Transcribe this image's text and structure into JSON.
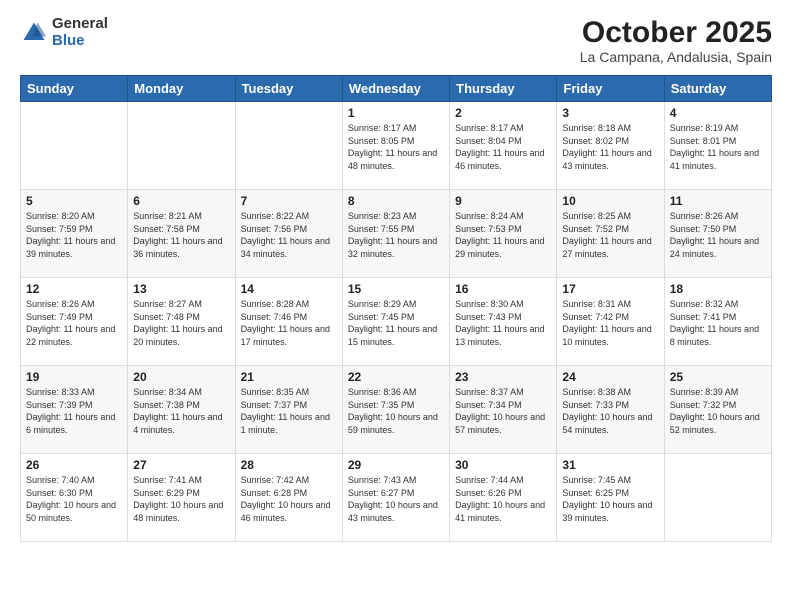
{
  "header": {
    "logo_general": "General",
    "logo_blue": "Blue",
    "month_title": "October 2025",
    "location": "La Campana, Andalusia, Spain"
  },
  "weekdays": [
    "Sunday",
    "Monday",
    "Tuesday",
    "Wednesday",
    "Thursday",
    "Friday",
    "Saturday"
  ],
  "weeks": [
    [
      {
        "day": "",
        "info": ""
      },
      {
        "day": "",
        "info": ""
      },
      {
        "day": "",
        "info": ""
      },
      {
        "day": "1",
        "info": "Sunrise: 8:17 AM\nSunset: 8:05 PM\nDaylight: 11 hours and 48 minutes."
      },
      {
        "day": "2",
        "info": "Sunrise: 8:17 AM\nSunset: 8:04 PM\nDaylight: 11 hours and 46 minutes."
      },
      {
        "day": "3",
        "info": "Sunrise: 8:18 AM\nSunset: 8:02 PM\nDaylight: 11 hours and 43 minutes."
      },
      {
        "day": "4",
        "info": "Sunrise: 8:19 AM\nSunset: 8:01 PM\nDaylight: 11 hours and 41 minutes."
      }
    ],
    [
      {
        "day": "5",
        "info": "Sunrise: 8:20 AM\nSunset: 7:59 PM\nDaylight: 11 hours and 39 minutes."
      },
      {
        "day": "6",
        "info": "Sunrise: 8:21 AM\nSunset: 7:58 PM\nDaylight: 11 hours and 36 minutes."
      },
      {
        "day": "7",
        "info": "Sunrise: 8:22 AM\nSunset: 7:56 PM\nDaylight: 11 hours and 34 minutes."
      },
      {
        "day": "8",
        "info": "Sunrise: 8:23 AM\nSunset: 7:55 PM\nDaylight: 11 hours and 32 minutes."
      },
      {
        "day": "9",
        "info": "Sunrise: 8:24 AM\nSunset: 7:53 PM\nDaylight: 11 hours and 29 minutes."
      },
      {
        "day": "10",
        "info": "Sunrise: 8:25 AM\nSunset: 7:52 PM\nDaylight: 11 hours and 27 minutes."
      },
      {
        "day": "11",
        "info": "Sunrise: 8:26 AM\nSunset: 7:50 PM\nDaylight: 11 hours and 24 minutes."
      }
    ],
    [
      {
        "day": "12",
        "info": "Sunrise: 8:26 AM\nSunset: 7:49 PM\nDaylight: 11 hours and 22 minutes."
      },
      {
        "day": "13",
        "info": "Sunrise: 8:27 AM\nSunset: 7:48 PM\nDaylight: 11 hours and 20 minutes."
      },
      {
        "day": "14",
        "info": "Sunrise: 8:28 AM\nSunset: 7:46 PM\nDaylight: 11 hours and 17 minutes."
      },
      {
        "day": "15",
        "info": "Sunrise: 8:29 AM\nSunset: 7:45 PM\nDaylight: 11 hours and 15 minutes."
      },
      {
        "day": "16",
        "info": "Sunrise: 8:30 AM\nSunset: 7:43 PM\nDaylight: 11 hours and 13 minutes."
      },
      {
        "day": "17",
        "info": "Sunrise: 8:31 AM\nSunset: 7:42 PM\nDaylight: 11 hours and 10 minutes."
      },
      {
        "day": "18",
        "info": "Sunrise: 8:32 AM\nSunset: 7:41 PM\nDaylight: 11 hours and 8 minutes."
      }
    ],
    [
      {
        "day": "19",
        "info": "Sunrise: 8:33 AM\nSunset: 7:39 PM\nDaylight: 11 hours and 6 minutes."
      },
      {
        "day": "20",
        "info": "Sunrise: 8:34 AM\nSunset: 7:38 PM\nDaylight: 11 hours and 4 minutes."
      },
      {
        "day": "21",
        "info": "Sunrise: 8:35 AM\nSunset: 7:37 PM\nDaylight: 11 hours and 1 minute."
      },
      {
        "day": "22",
        "info": "Sunrise: 8:36 AM\nSunset: 7:35 PM\nDaylight: 10 hours and 59 minutes."
      },
      {
        "day": "23",
        "info": "Sunrise: 8:37 AM\nSunset: 7:34 PM\nDaylight: 10 hours and 57 minutes."
      },
      {
        "day": "24",
        "info": "Sunrise: 8:38 AM\nSunset: 7:33 PM\nDaylight: 10 hours and 54 minutes."
      },
      {
        "day": "25",
        "info": "Sunrise: 8:39 AM\nSunset: 7:32 PM\nDaylight: 10 hours and 52 minutes."
      }
    ],
    [
      {
        "day": "26",
        "info": "Sunrise: 7:40 AM\nSunset: 6:30 PM\nDaylight: 10 hours and 50 minutes."
      },
      {
        "day": "27",
        "info": "Sunrise: 7:41 AM\nSunset: 6:29 PM\nDaylight: 10 hours and 48 minutes."
      },
      {
        "day": "28",
        "info": "Sunrise: 7:42 AM\nSunset: 6:28 PM\nDaylight: 10 hours and 46 minutes."
      },
      {
        "day": "29",
        "info": "Sunrise: 7:43 AM\nSunset: 6:27 PM\nDaylight: 10 hours and 43 minutes."
      },
      {
        "day": "30",
        "info": "Sunrise: 7:44 AM\nSunset: 6:26 PM\nDaylight: 10 hours and 41 minutes."
      },
      {
        "day": "31",
        "info": "Sunrise: 7:45 AM\nSunset: 6:25 PM\nDaylight: 10 hours and 39 minutes."
      },
      {
        "day": "",
        "info": ""
      }
    ]
  ]
}
